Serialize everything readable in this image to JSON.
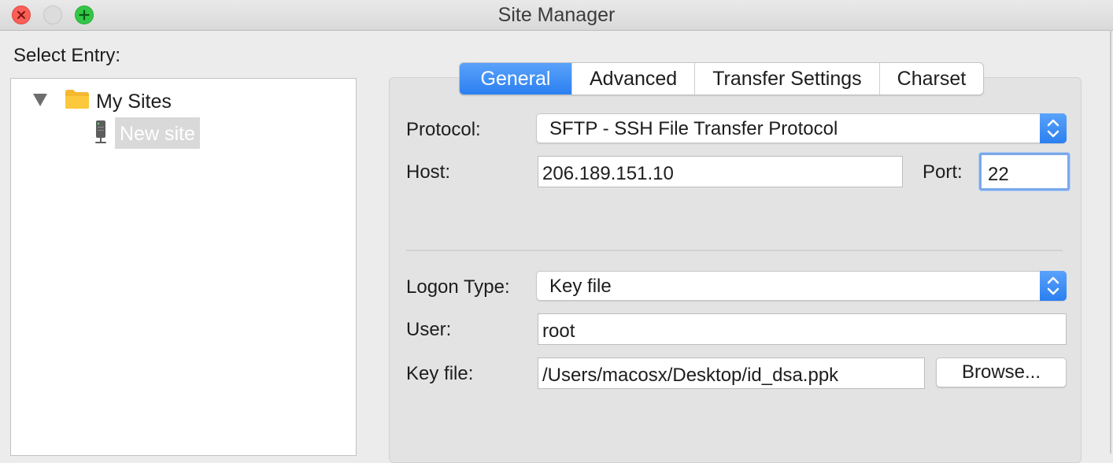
{
  "window": {
    "title": "Site Manager"
  },
  "left": {
    "select_label": "Select Entry:",
    "tree": {
      "folder_label": "My Sites",
      "site_label": "New site"
    }
  },
  "tabs": [
    {
      "label": "General",
      "active": true
    },
    {
      "label": "Advanced",
      "active": false
    },
    {
      "label": "Transfer Settings",
      "active": false
    },
    {
      "label": "Charset",
      "active": false
    }
  ],
  "form": {
    "protocol": {
      "label": "Protocol:",
      "value": "SFTP - SSH File Transfer Protocol"
    },
    "host": {
      "label": "Host:",
      "value": "206.189.151.10"
    },
    "port": {
      "label": "Port:",
      "value": "22"
    },
    "logon_type": {
      "label": "Logon Type:",
      "value": "Key file"
    },
    "user": {
      "label": "User:",
      "value": "root"
    },
    "key_file": {
      "label": "Key file:",
      "value": "/Users/macosx/Desktop/id_dsa.ppk"
    },
    "browse_label": "Browse..."
  },
  "colors": {
    "accent": "#2b7ff0",
    "close": "#fc5f57",
    "maximize": "#33c748",
    "folder": "#f7c035"
  },
  "icons": [
    "close-icon",
    "minimize-icon",
    "maximize-icon",
    "disclosure-triangle-icon",
    "folder-icon",
    "server-icon",
    "chevron-updown-icon"
  ]
}
